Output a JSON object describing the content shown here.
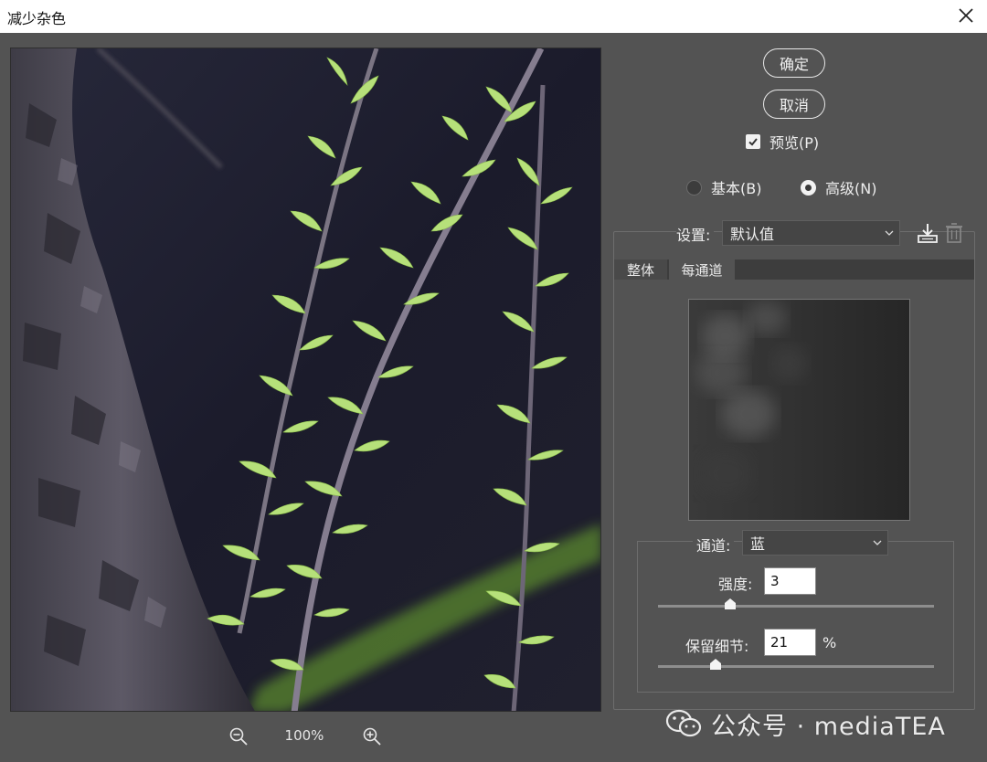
{
  "window": {
    "title": "减少杂色"
  },
  "zoom": {
    "level": "100%"
  },
  "buttons": {
    "ok": "确定",
    "cancel": "取消"
  },
  "preview_checkbox": {
    "label": "预览(P)",
    "checked": true
  },
  "mode": {
    "basic": "基本(B)",
    "advanced": "高级(N)",
    "selected": "advanced"
  },
  "settings": {
    "label": "设置:",
    "value": "默认值"
  },
  "tabs": [
    {
      "label": "整体"
    },
    {
      "label": "每通道"
    }
  ],
  "active_tab": "每通道",
  "channel": {
    "label": "通道:",
    "value": "蓝"
  },
  "strength": {
    "label": "强度:",
    "value": "3",
    "slider_fraction": 0.26
  },
  "preserve_details": {
    "label": "保留细节:",
    "value": "21",
    "unit": "%",
    "slider_fraction": 0.21
  },
  "watermark": {
    "text": "公众号 · mediaTEA"
  },
  "colors": {
    "dialog_bg": "#535353",
    "titlebar_bg": "#ffffff",
    "leaf_green": "#b6e07a"
  }
}
